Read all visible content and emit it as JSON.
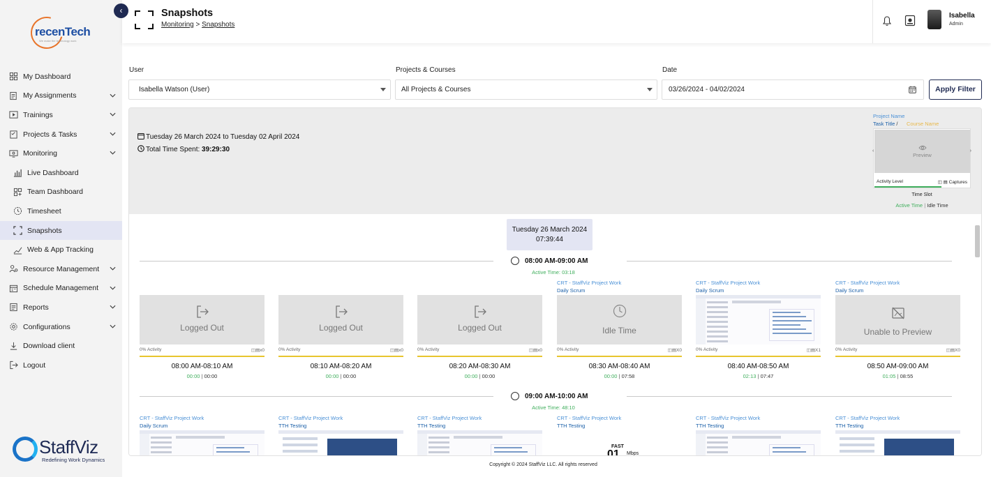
{
  "brand": {
    "name": "recenTech",
    "tagline": "We make the technology work"
  },
  "sidebar": {
    "items": [
      {
        "label": "My Dashboard",
        "icon": "dashboard-icon",
        "chevron": false
      },
      {
        "label": "My Assignments",
        "icon": "assignment-icon",
        "chevron": true
      },
      {
        "label": "Trainings",
        "icon": "play-icon",
        "chevron": true
      },
      {
        "label": "Projects & Tasks",
        "icon": "tasks-icon",
        "chevron": true
      },
      {
        "label": "Monitoring",
        "icon": "monitor-icon",
        "chevron": true
      },
      {
        "label": "Live Dashboard",
        "icon": "bar-chart-icon",
        "sub": true
      },
      {
        "label": "Team Dashboard",
        "icon": "grid-icon",
        "sub": true
      },
      {
        "label": "Timesheet",
        "icon": "clock-icon",
        "sub": true
      },
      {
        "label": "Snapshots",
        "icon": "snapshot-icon",
        "sub": true,
        "active": true
      },
      {
        "label": "Web & App Tracking",
        "icon": "tracking-icon",
        "sub": true
      },
      {
        "label": "Resource Management",
        "icon": "resource-icon",
        "chevron": true
      },
      {
        "label": "Schedule Management",
        "icon": "schedule-icon",
        "chevron": true
      },
      {
        "label": "Reports",
        "icon": "reports-icon",
        "chevron": true
      },
      {
        "label": "Configurations",
        "icon": "config-icon",
        "chevron": true
      },
      {
        "label": "Download client",
        "icon": "download-icon",
        "chevron": false
      },
      {
        "label": "Logout",
        "icon": "logout-icon",
        "chevron": false
      }
    ]
  },
  "staffviz": {
    "name": "StaffViz",
    "tagline": "Redefining Work Dynamics"
  },
  "header": {
    "title": "Snapshots",
    "breadcrumb": [
      "Monitoring",
      "Snapshots"
    ],
    "breadcrumb_sep": ">",
    "user": {
      "name": "Isabella",
      "role": "Admin"
    }
  },
  "filters": {
    "user_label": "User",
    "user_value": "Isabella Watson (User)",
    "project_label": "Projects & Courses",
    "project_value": "All Projects & Courses",
    "date_label": "Date",
    "date_value": "03/26/2024 - 04/02/2024",
    "apply_label": "Apply Filter"
  },
  "summary": {
    "range": "Tuesday 26 March 2024 to Tuesday 02 April 2024",
    "total_label": "Total Time Spent:",
    "total_value": "39:29:30"
  },
  "legend": {
    "project_name": "Project Name",
    "task_title": "Task Title",
    "separator": "/",
    "course_name": "Course Name",
    "preview": "Preview",
    "activity_level": "Activity Level",
    "captures": "Captures",
    "time_slot": "Time Slot",
    "active_time": "Active Time",
    "idle_time": "Idle Time",
    "colors": {
      "project": "#4a90d6",
      "task": "#1a5fa8",
      "course": "#e8b84a",
      "active": "#3fae5c"
    }
  },
  "day": {
    "date": "Tuesday 26 March 2024",
    "total": "07:39:44"
  },
  "hours": [
    {
      "label": "08:00 AM-09:00 AM",
      "active_time": "Active Time: 03:18",
      "slots": [
        {
          "state": "Logged Out",
          "project": "",
          "task": "",
          "activity": "0% Activity",
          "captures": "x0",
          "slot": "08:00 AM-08:10 AM",
          "active": "00:00",
          "idle": "00:00"
        },
        {
          "state": "Logged Out",
          "project": "",
          "task": "",
          "activity": "0% Activity",
          "captures": "x0",
          "slot": "08:10 AM-08:20 AM",
          "active": "00:00",
          "idle": "00:00"
        },
        {
          "state": "Logged Out",
          "project": "",
          "task": "",
          "activity": "0% Activity",
          "captures": "x0",
          "slot": "08:20 AM-08:30 AM",
          "active": "00:00",
          "idle": "00:00"
        },
        {
          "state": "Idle Time",
          "project": "CRT - StaffViz Project Work",
          "task": "Daily Scrum",
          "activity": "0% Activity",
          "captures": "X0",
          "slot": "08:30 AM-08:40 AM",
          "active": "00:00",
          "idle": "07:58"
        },
        {
          "state": "screenshot",
          "project": "CRT - StaffViz Project Work",
          "task": "Daily Scrum",
          "activity": "0% Activity",
          "captures": "X1",
          "slot": "08:40 AM-08:50 AM",
          "active": "02:13",
          "idle": "07:47"
        },
        {
          "state": "Unable to Preview",
          "project": "CRT - StaffViz Project Work",
          "task": "Daily Scrum",
          "activity": "0% Activity",
          "captures": "X0",
          "slot": "08:50 AM-09:00 AM",
          "active": "01:05",
          "idle": "08:55"
        }
      ]
    },
    {
      "label": "09:00 AM-10:00 AM",
      "active_time": "Active Time: 48:10",
      "slots": [
        {
          "project": "CRT - StaffViz Project Work",
          "task": "Daily Scrum"
        },
        {
          "project": "CRT - StaffViz Project Work",
          "task": "TTH Testing"
        },
        {
          "project": "CRT - StaffViz Project Work",
          "task": "TTH Testing"
        },
        {
          "project": "CRT - StaffViz Project Work",
          "task": "TTH Testing",
          "overlay_a": "FAST",
          "overlay_b": "Mbps",
          "overlay_c": "01"
        },
        {
          "project": "CRT - StaffViz Project Work",
          "task": "TTH Testing"
        },
        {
          "project": "CRT - StaffViz Project Work",
          "task": "TTH Testing"
        }
      ]
    }
  ],
  "footer": "Copyright © 2024 StaffViz LLC. All rights reserved"
}
